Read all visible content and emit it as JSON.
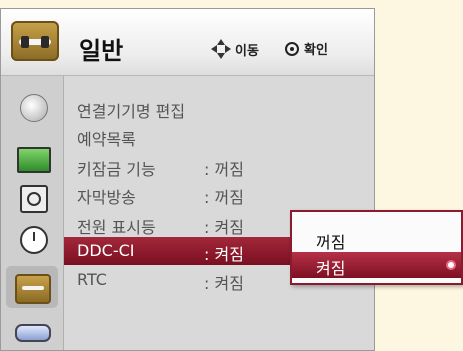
{
  "header": {
    "title": "일반",
    "nav_label": "이동",
    "ok_label": "확인"
  },
  "sidebar": {
    "icons": [
      "satellite-dish-icon",
      "screen-icon",
      "speaker-icon",
      "clock-icon",
      "option-icon",
      "input-icon"
    ],
    "selected": "option-icon"
  },
  "menu": {
    "items": [
      {
        "label": "연결기기명 편집",
        "value": ""
      },
      {
        "label": "예약목록",
        "value": ""
      },
      {
        "label": "키잠금 기능",
        "value": ": 꺼짐"
      },
      {
        "label": "자막방송",
        "value": ": 꺼짐"
      },
      {
        "label": "전원 표시등",
        "value": ": 켜짐"
      },
      {
        "label": "DDC-CI",
        "value": ": 켜짐"
      },
      {
        "label": "RTC",
        "value": ": 켜짐"
      }
    ],
    "selected_index": 5
  },
  "popup": {
    "options": [
      "꺼짐",
      "켜짐"
    ],
    "selected_index": 1
  },
  "colors": {
    "highlight": "#8b1a2c",
    "background": "#fdf7e2"
  }
}
